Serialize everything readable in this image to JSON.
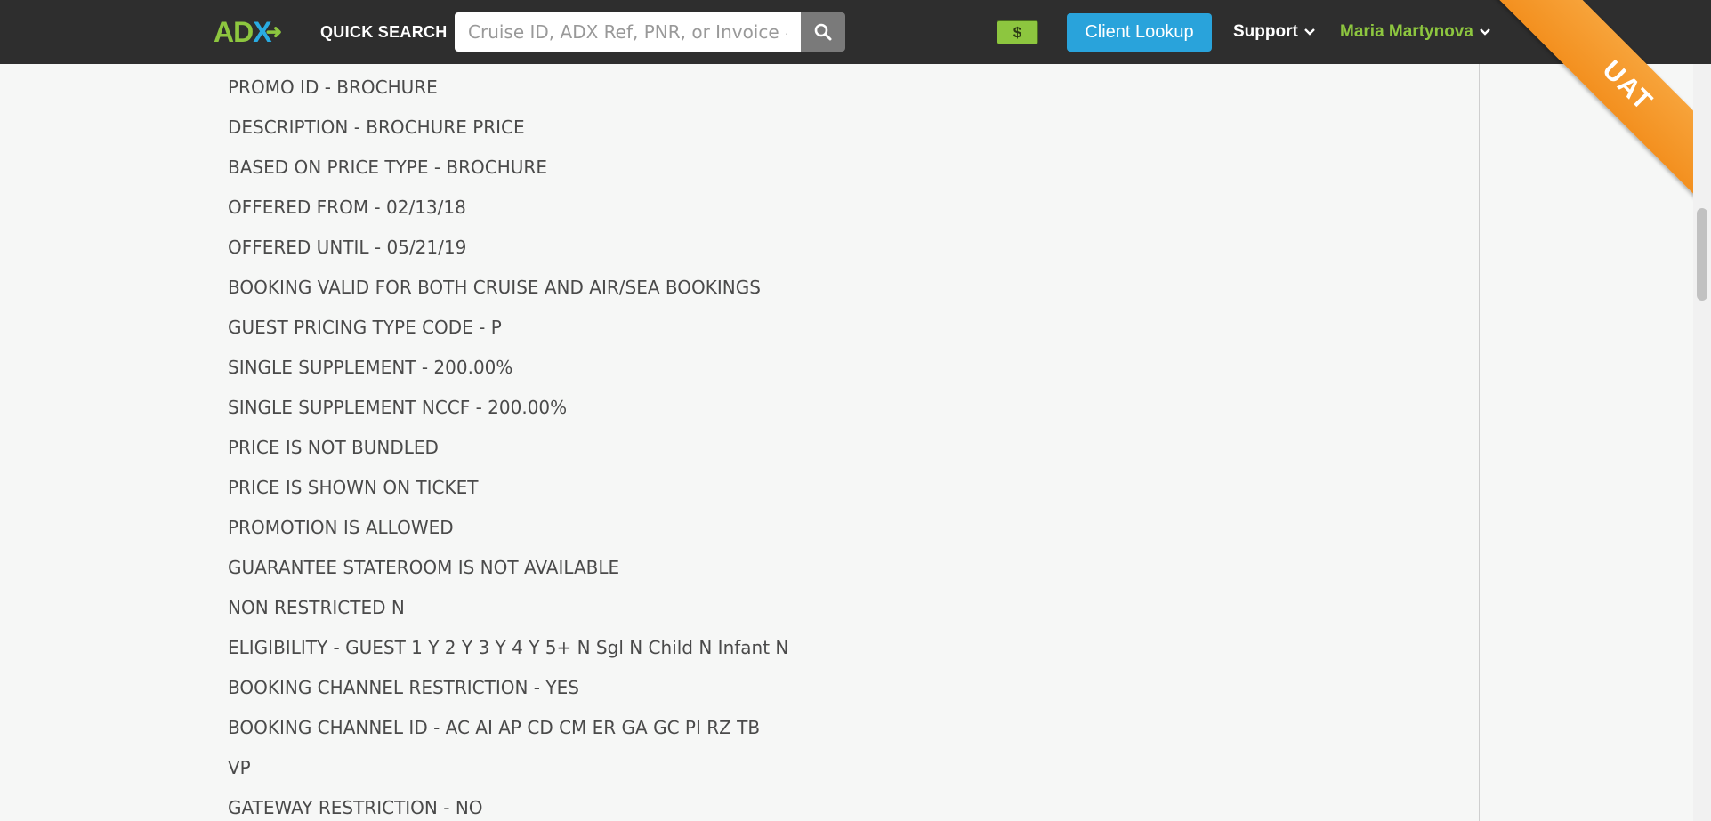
{
  "navbar": {
    "logo_letters": "AD",
    "logo_x": "X",
    "quick_search_label": "QUICK SEARCH",
    "search": {
      "placeholder": "Cruise ID, ADX Ref, PNR, or Invoice #.",
      "value": ""
    },
    "search_icon": "search-icon",
    "dollar_label": "$",
    "client_lookup_label": "Client Lookup",
    "support_label": "Support",
    "user_name": "Maria Martynova"
  },
  "ribbon": {
    "label": "UAT",
    "color": "#f7a33a"
  },
  "colors": {
    "navbar": "#2e2e2e",
    "accent_green": "#8dc63f",
    "accent_blue": "#29a3db"
  },
  "promo_details": [
    "PROMO ID - BROCHURE",
    "DESCRIPTION - BROCHURE PRICE",
    "BASED ON PRICE TYPE - BROCHURE",
    "OFFERED FROM - 02/13/18",
    "OFFERED UNTIL - 05/21/19",
    "BOOKING VALID FOR BOTH CRUISE AND AIR/SEA BOOKINGS",
    "GUEST PRICING TYPE CODE - P",
    "SINGLE SUPPLEMENT - 200.00%",
    "SINGLE SUPPLEMENT NCCF - 200.00%",
    "PRICE IS NOT BUNDLED",
    "PRICE IS SHOWN ON TICKET",
    "PROMOTION IS ALLOWED",
    "GUARANTEE STATEROOM IS NOT AVAILABLE",
    "NON RESTRICTED N",
    "ELIGIBILITY - GUEST 1 Y 2 Y 3 Y 4 Y 5+ N Sgl N Child N Infant N",
    "BOOKING CHANNEL RESTRICTION - YES",
    "BOOKING CHANNEL ID - AC AI AP CD CM ER GA GC PI RZ TB",
    "VP",
    "GATEWAY RESTRICTION - NO"
  ]
}
